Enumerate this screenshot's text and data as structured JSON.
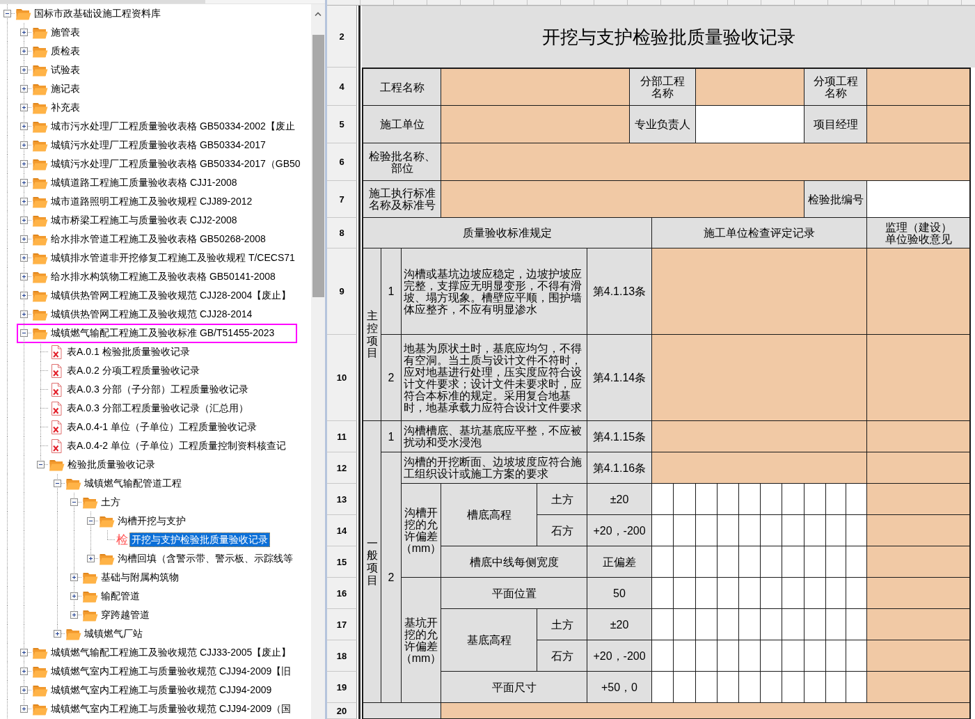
{
  "tree": {
    "items": [
      {
        "label": "国标市政基础设施工程资料库",
        "kind": "folder",
        "expanded": true,
        "selected": false,
        "highlighted": false,
        "children": [
          {
            "label": "施管表",
            "kind": "folder",
            "expanded": false,
            "selected": false,
            "highlighted": false
          },
          {
            "label": "质检表",
            "kind": "folder",
            "expanded": false,
            "selected": false,
            "highlighted": false
          },
          {
            "label": "试验表",
            "kind": "folder",
            "expanded": false,
            "selected": false,
            "highlighted": false
          },
          {
            "label": "施记表",
            "kind": "folder",
            "expanded": false,
            "selected": false,
            "highlighted": false
          },
          {
            "label": "补充表",
            "kind": "folder",
            "expanded": false,
            "selected": false,
            "highlighted": false
          },
          {
            "label": "城市污水处理厂工程质量验收表格 GB50334-2002【废止",
            "kind": "folder",
            "expanded": false,
            "selected": false,
            "highlighted": false
          },
          {
            "label": "城镇污水处理厂工程质量验收表格 GB50334-2017",
            "kind": "folder",
            "expanded": false,
            "selected": false,
            "highlighted": false
          },
          {
            "label": "城镇污水处理厂工程质量验收表格 GB50334-2017（GB50",
            "kind": "folder",
            "expanded": false,
            "selected": false,
            "highlighted": false
          },
          {
            "label": "城镇道路工程施工质量验收表格 CJJ1-2008",
            "kind": "folder",
            "expanded": false,
            "selected": false,
            "highlighted": false
          },
          {
            "label": "城市道路照明工程施工及验收规程 CJJ89-2012",
            "kind": "folder",
            "expanded": false,
            "selected": false,
            "highlighted": false
          },
          {
            "label": "城市桥梁工程施工与质量验收表 CJJ2-2008",
            "kind": "folder",
            "expanded": false,
            "selected": false,
            "highlighted": false
          },
          {
            "label": "给水排水管道工程施工及验收表格 GB50268-2008",
            "kind": "folder",
            "expanded": false,
            "selected": false,
            "highlighted": false
          },
          {
            "label": "城镇排水管道非开挖修复工程施工及验收规程 T/CECS71",
            "kind": "folder",
            "expanded": false,
            "selected": false,
            "highlighted": false
          },
          {
            "label": "给水排水构筑物工程施工及验收表格 GB50141-2008",
            "kind": "folder",
            "expanded": false,
            "selected": false,
            "highlighted": false
          },
          {
            "label": "城镇供热管网工程施工及验收规范 CJJ28-2004【废止】",
            "kind": "folder",
            "expanded": false,
            "selected": false,
            "highlighted": false
          },
          {
            "label": "城镇供热管网工程施工及验收规范 CJJ28-2014",
            "kind": "folder",
            "expanded": false,
            "selected": false,
            "highlighted": false
          },
          {
            "label": "城镇燃气输配工程施工及验收标准 GB/T51455-2023",
            "kind": "folder",
            "expanded": true,
            "selected": false,
            "highlighted": true,
            "children": [
              {
                "label": "表A.0.1 检验批质量验收记录",
                "kind": "file",
                "selected": false,
                "highlighted": false
              },
              {
                "label": "表A.0.2 分项工程质量验收记录",
                "kind": "file",
                "selected": false,
                "highlighted": false
              },
              {
                "label": "表A.0.3 分部（子分部）工程质量验收记录",
                "kind": "file",
                "selected": false,
                "highlighted": false
              },
              {
                "label": "表A.0.3 分部工程质量验收记录（汇总用）",
                "kind": "file",
                "selected": false,
                "highlighted": false
              },
              {
                "label": "表A.0.4-1 单位（子单位）工程质量验收记录",
                "kind": "file",
                "selected": false,
                "highlighted": false
              },
              {
                "label": "表A.0.4-2 单位（子单位）工程质量控制资料核查记",
                "kind": "file",
                "selected": false,
                "highlighted": false
              },
              {
                "label": "检验批质量验收记录",
                "kind": "folder",
                "expanded": true,
                "selected": false,
                "highlighted": false,
                "children": [
                  {
                    "label": "城镇燃气输配管道工程",
                    "kind": "folder",
                    "expanded": true,
                    "selected": false,
                    "highlighted": false,
                    "children": [
                      {
                        "label": "土方",
                        "kind": "folder",
                        "expanded": true,
                        "selected": false,
                        "highlighted": false,
                        "children": [
                          {
                            "label": "沟槽开挖与支护",
                            "kind": "folder",
                            "expanded": true,
                            "selected": false,
                            "highlighted": false,
                            "children": [
                              {
                                "label": "开挖与支护检验批质量验收记录",
                                "kind": "record",
                                "glyph": "检",
                                "selected": true,
                                "highlighted": false
                              }
                            ]
                          },
                          {
                            "label": "沟槽回填（含警示带、警示板、示踪线等",
                            "kind": "folder",
                            "expanded": false,
                            "selected": false,
                            "highlighted": false
                          }
                        ]
                      },
                      {
                        "label": "基础与附属构筑物",
                        "kind": "folder",
                        "expanded": false,
                        "selected": false,
                        "highlighted": false
                      },
                      {
                        "label": "输配管道",
                        "kind": "folder",
                        "expanded": false,
                        "selected": false,
                        "highlighted": false
                      },
                      {
                        "label": "穿跨越管道",
                        "kind": "folder",
                        "expanded": false,
                        "selected": false,
                        "highlighted": false
                      }
                    ]
                  },
                  {
                    "label": "城镇燃气厂站",
                    "kind": "folder",
                    "expanded": false,
                    "selected": false,
                    "highlighted": false
                  }
                ]
              }
            ]
          },
          {
            "label": "城镇燃气输配工程施工及验收规范 CJJ33-2005【废止】",
            "kind": "folder",
            "expanded": false,
            "selected": false,
            "highlighted": false
          },
          {
            "label": "城镇燃气室内工程施工与质量验收规范 CJJ94-2009【旧",
            "kind": "folder",
            "expanded": false,
            "selected": false,
            "highlighted": false
          },
          {
            "label": "城镇燃气室内工程施工与质量验收规范 CJJ94-2009",
            "kind": "folder",
            "expanded": false,
            "selected": false,
            "highlighted": false
          },
          {
            "label": "城镇燃气室内工程施工与质量验收规范 CJJ94-2009（国",
            "kind": "folder",
            "expanded": false,
            "selected": false,
            "highlighted": false
          }
        ]
      }
    ]
  },
  "sheet": {
    "title": "开挖与支护检验批质量验收记录",
    "row_numbers": [
      "2",
      "4",
      "5",
      "6",
      "7",
      "8",
      "9",
      "10",
      "11",
      "12",
      "13",
      "14",
      "15",
      "16",
      "17",
      "18",
      "19",
      "20"
    ],
    "info_fields": [
      {
        "label": "工程名称",
        "shaded": true
      },
      {
        "label": "分部工程名称",
        "shaded": true
      },
      {
        "label": "分项工程名称",
        "shaded": true
      },
      {
        "label": "施工单位",
        "shaded": true
      },
      {
        "label": "专业负责人",
        "shaded": false
      },
      {
        "label": "项目经理",
        "shaded": true
      },
      {
        "label": "检验批名称、部位",
        "shaded": true
      },
      {
        "label": "施工执行标准名称及标准号",
        "shaded": true
      },
      {
        "label": "检验批编号",
        "shaded": false
      }
    ],
    "column_headers": [
      "质量验收标准规定",
      "施工单位检查评定记录",
      "监理（建设）单位验收意见"
    ],
    "sections": [
      {
        "label": "主控项目",
        "items": [
          {
            "number": "1",
            "requirement": "沟槽或基坑边坡应稳定，边坡护坡应完整，支撑应无明显变形，不得有滑坡、塌方现象。槽壁应平顺，围护墙体应整齐，不应有明显渗水",
            "clause": "第4.1.13条"
          },
          {
            "number": "2",
            "requirement": "地基为原状土时，基底应均匀，不得有空洞。当土质与设计文件不符时，应对地基进行处理，压实度应符合设计文件要求；设计文件未要求时，应符合本标准的规定。采用复合地基时，地基承载力应符合设计文件要求",
            "clause": "第4.1.14条"
          }
        ]
      },
      {
        "label": "一般项目",
        "items": [
          {
            "number": "1",
            "requirement": "沟槽槽底、基坑基底应平整，不应被扰动和受水浸泡",
            "clause": "第4.1.15条"
          },
          {
            "number": "2",
            "requirement": "沟槽的开挖断面、边坡坡度应符合施工组织设计或施工方案的要求",
            "clause": "第4.1.16条",
            "tolerances": [
              {
                "label": "沟槽开挖的允许偏差（mm）",
                "entries": [
                  {
                    "item": "槽底高程",
                    "subitems": [
                      {
                        "name": "土方",
                        "value": "±20"
                      },
                      {
                        "name": "石方",
                        "value": "+20，-200"
                      }
                    ]
                  },
                  {
                    "item": "槽底中线每侧宽度",
                    "value": "正偏差"
                  }
                ]
              },
              {
                "label": "基坑开挖的允许偏差（mm）",
                "entries": [
                  {
                    "item": "平面位置",
                    "value": "50"
                  },
                  {
                    "item": "基底高程",
                    "subitems": [
                      {
                        "name": "土方",
                        "value": "±20"
                      },
                      {
                        "name": "石方",
                        "value": "+20，-200"
                      }
                    ]
                  },
                  {
                    "item": "平面尺寸",
                    "value": "+50，0"
                  }
                ]
              }
            ]
          }
        ]
      }
    ],
    "footer_row": {
      "shaded": true
    }
  }
}
